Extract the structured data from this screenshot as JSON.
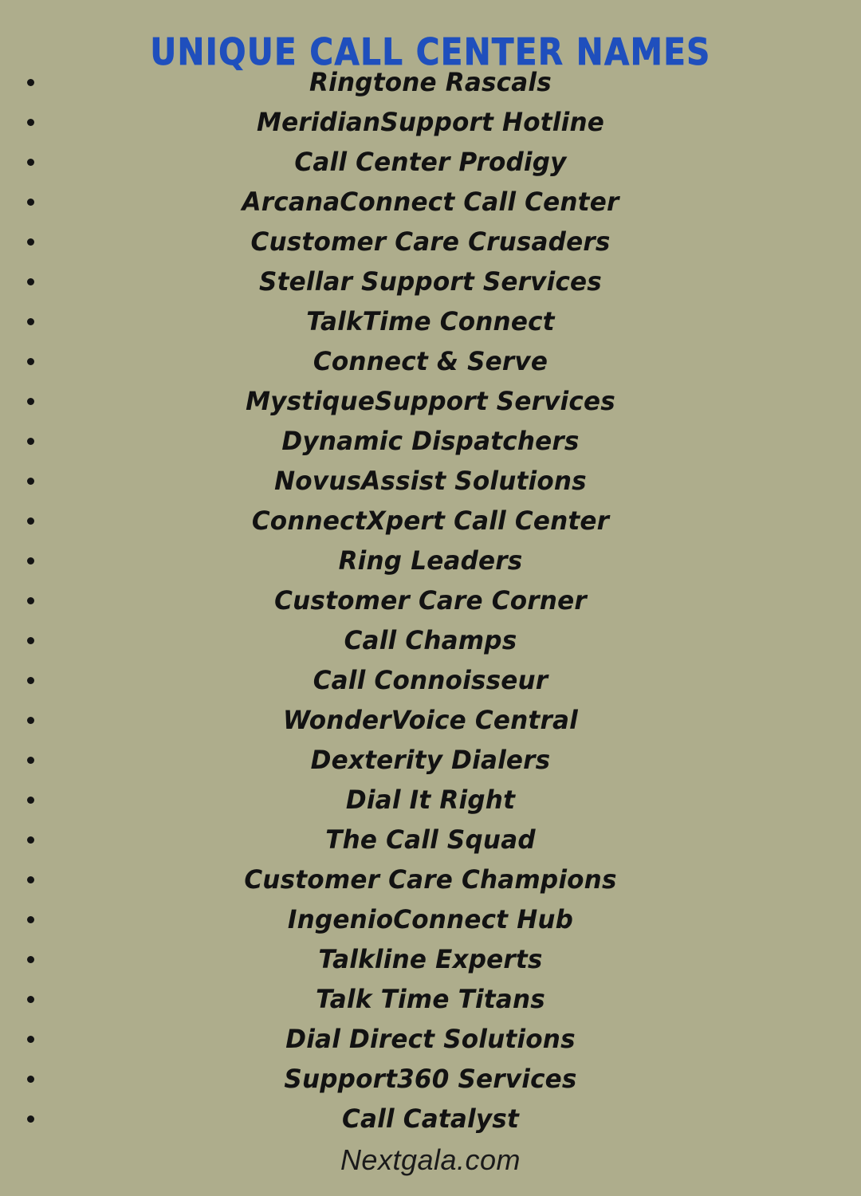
{
  "page": {
    "background_color": "#aead8c",
    "text_color": "#121212"
  },
  "header": {
    "title": "Unique Call Center Names",
    "title_color": "#1f4fbd"
  },
  "list": {
    "bullet_icon": "bullet-dot-icon",
    "items": [
      {
        "label": "Ringtone Rascals"
      },
      {
        "label": "MeridianSupport Hotline"
      },
      {
        "label": "Call Center Prodigy"
      },
      {
        "label": "ArcanaConnect Call Center"
      },
      {
        "label": "Customer Care Crusaders"
      },
      {
        "label": "Stellar Support Services"
      },
      {
        "label": "TalkTime Connect"
      },
      {
        "label": "Connect & Serve"
      },
      {
        "label": "MystiqueSupport Services"
      },
      {
        "label": "Dynamic Dispatchers"
      },
      {
        "label": "NovusAssist Solutions"
      },
      {
        "label": "ConnectXpert Call Center"
      },
      {
        "label": "Ring Leaders"
      },
      {
        "label": "Customer Care Corner"
      },
      {
        "label": "Call Champs"
      },
      {
        "label": "Call Connoisseur"
      },
      {
        "label": "WonderVoice Central"
      },
      {
        "label": "Dexterity Dialers"
      },
      {
        "label": "Dial It Right"
      },
      {
        "label": "The Call Squad"
      },
      {
        "label": "Customer Care Champions"
      },
      {
        "label": "IngenioConnect Hub"
      },
      {
        "label": "Talkline Experts"
      },
      {
        "label": "Talk Time Titans"
      },
      {
        "label": "Dial Direct Solutions"
      },
      {
        "label": "Support360 Services"
      },
      {
        "label": "Call Catalyst"
      }
    ]
  },
  "footer": {
    "site": "Nextgala.com"
  }
}
